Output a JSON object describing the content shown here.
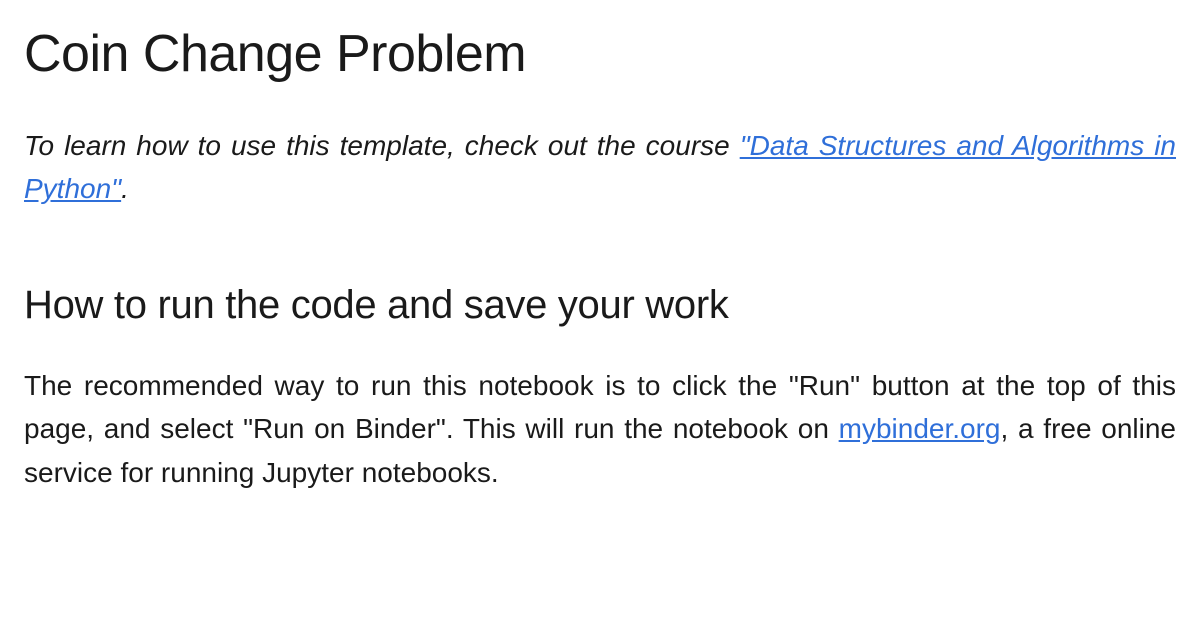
{
  "title": "Coin Change Problem",
  "intro": {
    "prefix": "To learn how to use this template, check out the course ",
    "link_text": "\"Data Structures and Algorithms in Python\"",
    "suffix": "."
  },
  "section": {
    "heading": "How to run the code and save your work",
    "body_prefix": "The recommended way to run this notebook is to click the \"Run\" button at the top of this page, and select \"Run on Binder\". This will run the notebook on ",
    "body_link_text": "mybinder.org",
    "body_suffix": ", a free online service for running Jupyter notebooks."
  }
}
